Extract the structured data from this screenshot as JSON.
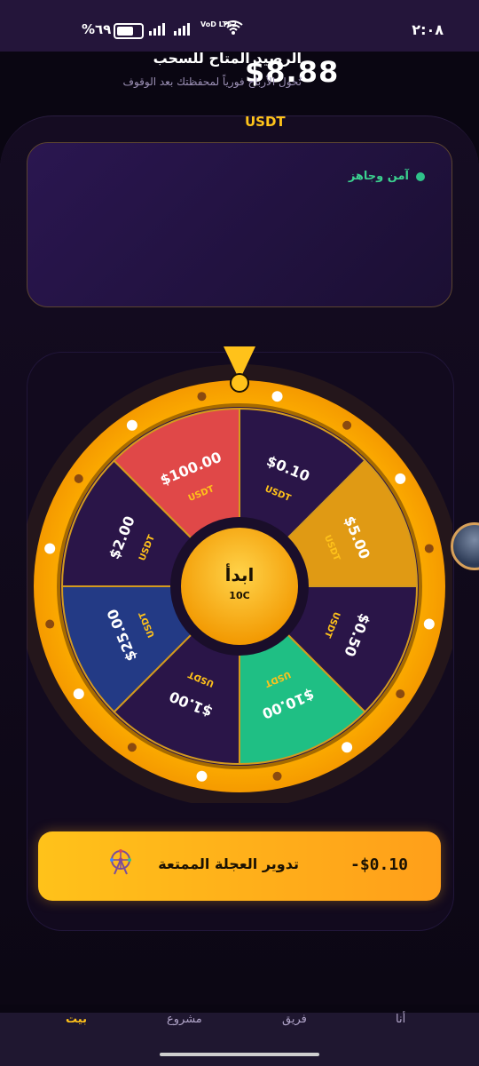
{
  "status_bar": {
    "time": "٢:٠٨",
    "battery": "%٦٩",
    "battery_level": 0.69,
    "network": "VoD LTE2"
  },
  "balance": {
    "secure_status": "آمن وجاهز",
    "amount": "$8.88",
    "currency": "USDT",
    "available_label": "الرصيد المتاح للسحب",
    "available_desc": "تُحول الأرباح فورياً لمحفظتك بعد الوقوف"
  },
  "wheel": {
    "center_label": "ابدأ",
    "center_sub": "10C",
    "segment_currency": "USDT",
    "segments": [
      {
        "value": "$0.10",
        "color": "#2a1548"
      },
      {
        "value": "$5.00",
        "color": "#e09a14"
      },
      {
        "value": "$0.50",
        "color": "#2a1548"
      },
      {
        "value": "$10.00",
        "color": "#1fbf84"
      },
      {
        "value": "$1.00",
        "color": "#2a1548"
      },
      {
        "value": "$25.00",
        "color": "#233a85"
      },
      {
        "value": "$2.00",
        "color": "#2a1548"
      },
      {
        "value": "$100.00",
        "color": "#e04848"
      }
    ]
  },
  "spin_button": {
    "label": "تدوير العجلة الممتعة",
    "price": "-$0.10"
  },
  "nav": {
    "home": "بيت",
    "project": "مشروع",
    "team": "فريق",
    "me": "أنا"
  },
  "colors": {
    "accent": "#ffc21a",
    "secure": "#2fc28a",
    "background": "#0a0612"
  },
  "icons": [
    "battery-icon",
    "signal-icon",
    "wifi-icon",
    "pointer-icon",
    "ferris-wheel-icon",
    "avatar"
  ]
}
